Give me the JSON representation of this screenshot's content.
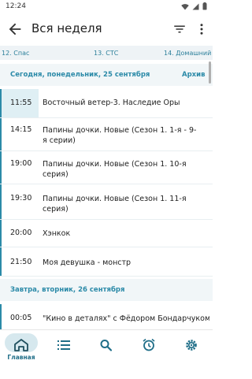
{
  "status": {
    "time": "12:24"
  },
  "appbar": {
    "title": "Вся неделя"
  },
  "channels": [
    {
      "label": "12. Спас"
    },
    {
      "label": "13. СТС"
    },
    {
      "label": "14. Домашний"
    }
  ],
  "today": {
    "header": "Сегодня, понедельник, 25 сентября",
    "archive": "Архив",
    "items": [
      {
        "time": "11:55",
        "title": "Восточный ветер-3. Наследие Оры"
      },
      {
        "time": "14:15",
        "title": "Папины дочки. Новые (Сезон 1. 1-я - 9-я серии)"
      },
      {
        "time": "19:00",
        "title": "Папины дочки. Новые (Сезон 1. 10-я серия)"
      },
      {
        "time": "19:30",
        "title": "Папины дочки. Новые (Сезон 1. 11-я серия)"
      },
      {
        "time": "20:00",
        "title": "Хэнкок"
      },
      {
        "time": "21:50",
        "title": "Моя девушка - монстр"
      }
    ]
  },
  "tomorrow": {
    "header": "Завтра, вторник, 26 сентября",
    "items": [
      {
        "time": "00:05",
        "title": "\"Кино в деталях\" с Фёдором Бондарчуком"
      }
    ]
  },
  "nav": {
    "home_label": "Главная",
    "accent": "#1f6e88"
  }
}
